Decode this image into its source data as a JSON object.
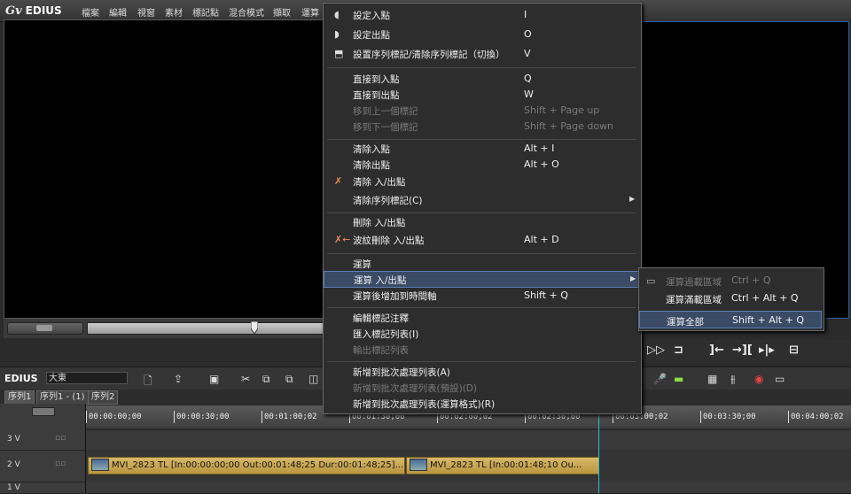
{
  "app": {
    "logo": "EDIUS"
  },
  "menubar": [
    "檔案",
    "編輯",
    "視窗",
    "素材",
    "標記點",
    "混合模式",
    "擷取",
    "運算"
  ],
  "timeline_toolbar": {
    "label": "EDIUS",
    "project_name": "大東"
  },
  "sequence_tabs": [
    "序列1",
    "序列1 - (1)",
    "序列2"
  ],
  "ruler_timecodes": [
    "00:00:00;00",
    "00:00:30;00",
    "00:01:00;02",
    "00:01:30;00",
    "00:02:00;02",
    "00:02:30;00",
    "00:03:00;02",
    "00:03:30;00",
    "00:04:00;02"
  ],
  "tracks": [
    {
      "label": "3 V"
    },
    {
      "label": "2 V"
    },
    {
      "label": "1 V"
    }
  ],
  "clips": [
    {
      "text": "MVI_2823   TL [In:00:00:00;00 Out:00:01:48;25 Dur:00:01:48;25]..."
    },
    {
      "text": "MVI_2823   TL [In:00:01:48;10 Ou..."
    }
  ],
  "context_menu": {
    "groups": [
      [
        {
          "label": "設定入點",
          "key": "I",
          "icon": "mark-in-icon"
        },
        {
          "label": "設定出點",
          "key": "O",
          "icon": "mark-out-icon"
        },
        {
          "label": "設置序列標記/清除序列標記（切換）",
          "key": "V",
          "icon": "sequence-mark-icon"
        }
      ],
      [
        {
          "label": "直接到入點",
          "key": "Q"
        },
        {
          "label": "直接到出點",
          "key": "W"
        },
        {
          "label": "移到上一個標記",
          "key": "Shift + Page up",
          "disabled": true
        },
        {
          "label": "移到下一個標記",
          "key": "Shift + Page down",
          "disabled": true
        }
      ],
      [
        {
          "label": "清除入點",
          "key": "Alt + I"
        },
        {
          "label": "清除出點",
          "key": "Alt + O"
        },
        {
          "label": "清除 入/出點",
          "key": "",
          "icon": "clear-in-out-icon"
        },
        {
          "label": "清除序列標記(C)",
          "key": "",
          "submenu": true
        }
      ],
      [
        {
          "label": "刪除 入/出點",
          "key": ""
        },
        {
          "label": "波紋刪除 入/出點",
          "key": "Alt + D",
          "icon": "ripple-delete-icon"
        }
      ],
      [
        {
          "label": "運算",
          "key": ""
        },
        {
          "label": "運算 入/出點",
          "key": "",
          "submenu": true,
          "highlighted": true
        },
        {
          "label": "運算後增加到時間軸",
          "key": "Shift + Q"
        }
      ],
      [
        {
          "label": "編輯標記注釋",
          "key": ""
        },
        {
          "label": "匯入標記列表(I)",
          "key": ""
        },
        {
          "label": "輸出標記列表",
          "key": "",
          "disabled": true
        }
      ],
      [
        {
          "label": "新增到批次處理列表(A)",
          "key": ""
        },
        {
          "label": "新增到批次處理列表(預設)(D)",
          "key": "",
          "disabled": true
        },
        {
          "label": "新增到批次處理列表(運算格式)(R)",
          "key": ""
        }
      ]
    ]
  },
  "submenu": [
    {
      "label": "運算過載區域",
      "key": "Ctrl + Q",
      "disabled": true
    },
    {
      "label": "運算滿載區域",
      "key": "Ctrl + Alt + Q"
    },
    {
      "label": "運算全部",
      "key": "Shift + Alt + Q",
      "highlighted": true
    }
  ]
}
